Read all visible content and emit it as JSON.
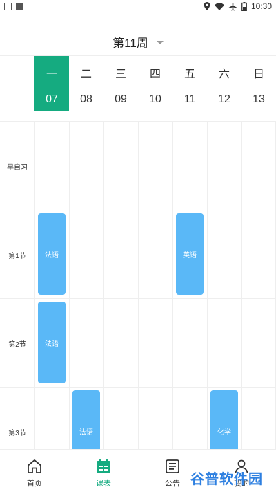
{
  "status_bar": {
    "time": "10:30"
  },
  "week": {
    "title": "第11周"
  },
  "days": [
    {
      "name": "一",
      "date": "07",
      "active": true
    },
    {
      "name": "二",
      "date": "08",
      "active": false
    },
    {
      "name": "三",
      "date": "09",
      "active": false
    },
    {
      "name": "四",
      "date": "10",
      "active": false
    },
    {
      "name": "五",
      "date": "11",
      "active": false
    },
    {
      "name": "六",
      "date": "12",
      "active": false
    },
    {
      "name": "日",
      "date": "13",
      "active": false
    }
  ],
  "periods": [
    {
      "label": "早自习"
    },
    {
      "label": "第1节"
    },
    {
      "label": "第2节"
    },
    {
      "label": "第3节"
    }
  ],
  "courses": [
    {
      "name": "法语",
      "day": 0,
      "period": 1
    },
    {
      "name": "英语",
      "day": 4,
      "period": 1
    },
    {
      "name": "法语",
      "day": 0,
      "period": 2
    },
    {
      "name": "法语",
      "day": 1,
      "period": 3
    },
    {
      "name": "化学",
      "day": 5,
      "period": 3
    }
  ],
  "tabs": [
    {
      "label": "首页",
      "icon": "home-icon",
      "active": false
    },
    {
      "label": "课表",
      "icon": "timetable-icon",
      "active": true
    },
    {
      "label": "公告",
      "icon": "notice-icon",
      "active": false
    },
    {
      "label": "我的",
      "icon": "profile-icon",
      "active": false
    }
  ],
  "colors": {
    "accent": "#15ab80",
    "course": "#5ab8f7"
  },
  "watermark": {
    "text": "谷普软件园"
  }
}
